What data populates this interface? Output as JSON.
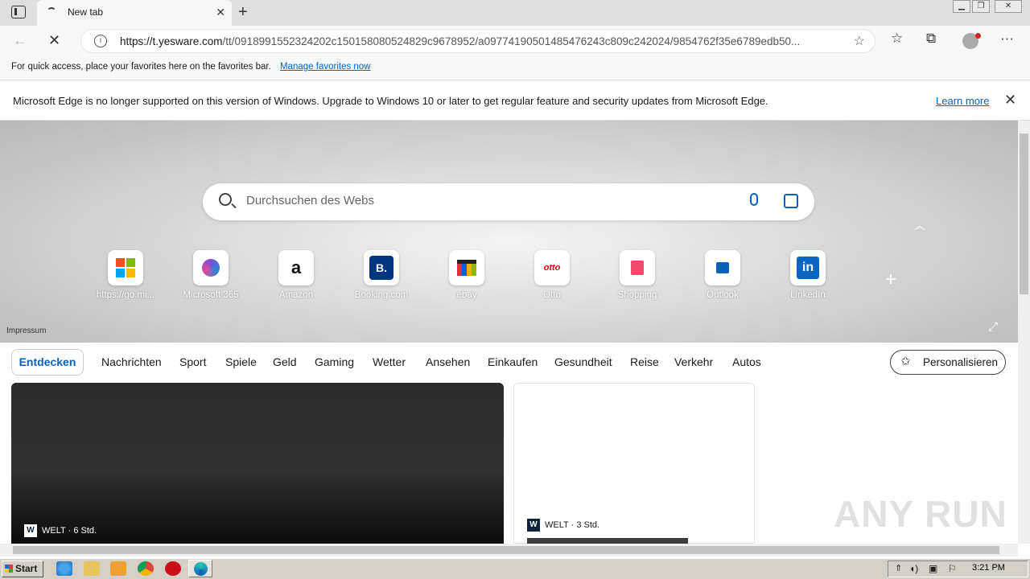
{
  "browser": {
    "tab_title": "New tab",
    "url_host": "https://t.yesware.com",
    "url_path": "/tt/0918991552324202c150158080524829c9678952/a097741905014854​76243c809c242024/9854762f35e6789edb50...",
    "favorites_hint": "For quick access, place your favorites here on the favorites bar.",
    "favorites_link": "Manage favorites now",
    "info_message": "Microsoft Edge is no longer supported on this version of Windows. Upgrade to Windows 10 or later to get regular feature and security updates from Microsoft Edge.",
    "info_link": "Learn more"
  },
  "search": {
    "placeholder": "Durchsuchen des Webs"
  },
  "tiles": [
    {
      "label": "https://go.mi...",
      "icon": "microsoft-icon"
    },
    {
      "label": "Microsoft 365",
      "icon": "m365-icon"
    },
    {
      "label": "Amazon",
      "icon": "amazon-icon"
    },
    {
      "label": "Booking.com",
      "icon": "booking-icon"
    },
    {
      "label": "ebay",
      "icon": "ebay-icon"
    },
    {
      "label": "Otto",
      "icon": "otto-icon"
    },
    {
      "label": "Shopping",
      "icon": "shopping-icon"
    },
    {
      "label": "Outlook",
      "icon": "outlook-icon"
    },
    {
      "label": "LinkedIn",
      "icon": "linkedin-icon"
    }
  ],
  "impressum": "Impressum",
  "feed_nav": {
    "active": "Entdecken",
    "items": [
      "Nachrichten",
      "Sport",
      "Spiele",
      "Geld",
      "Gaming",
      "Wetter",
      "Ansehen",
      "Einkaufen",
      "Gesundheit",
      "Reise",
      "Verkehr",
      "Autos"
    ],
    "personalize": "Personalisieren"
  },
  "cards": [
    {
      "source": "WELT · 6 Std.",
      "logo": "W"
    },
    {
      "source": "WELT · 3 Std.",
      "logo": "W"
    }
  ],
  "taskbar": {
    "start": "Start",
    "clock": "3:21 PM"
  },
  "watermark": "ANY RUN",
  "colors": {
    "accent": "#0a62b8",
    "link": "#0a62b8"
  }
}
